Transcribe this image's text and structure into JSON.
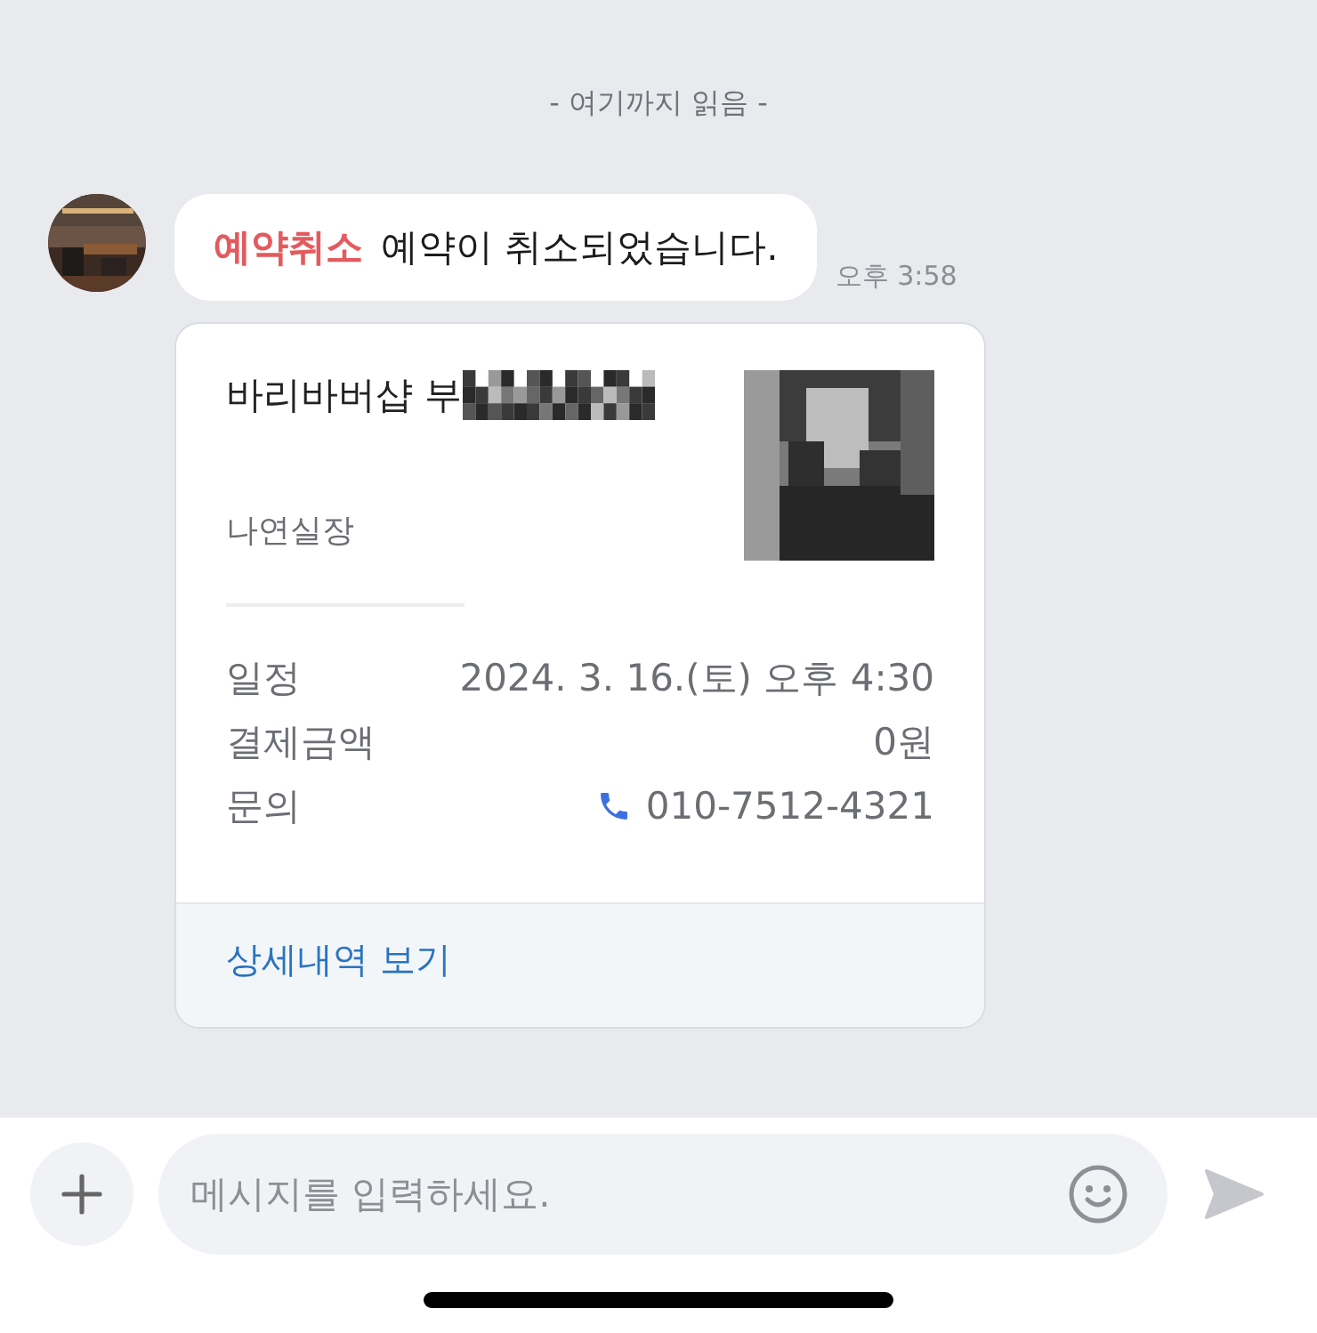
{
  "read_marker": "- 여기까지 읽음 -",
  "message": {
    "tag": "예약취소",
    "text": "예약이 취소되었습니다.",
    "time": "오후 3:58"
  },
  "card": {
    "shop": "바리바버샵 부",
    "staff": "나연실장",
    "details": [
      {
        "kind": "text",
        "label": "일정",
        "value": "2024. 3. 16.(토) 오후 4:30"
      },
      {
        "kind": "text",
        "label": "결제금액",
        "value": "0원"
      },
      {
        "kind": "phone",
        "label": "문의",
        "value": "010-7512-4321"
      }
    ],
    "link": "상세내역 보기"
  },
  "composer": {
    "placeholder": "메시지를 입력하세요."
  }
}
